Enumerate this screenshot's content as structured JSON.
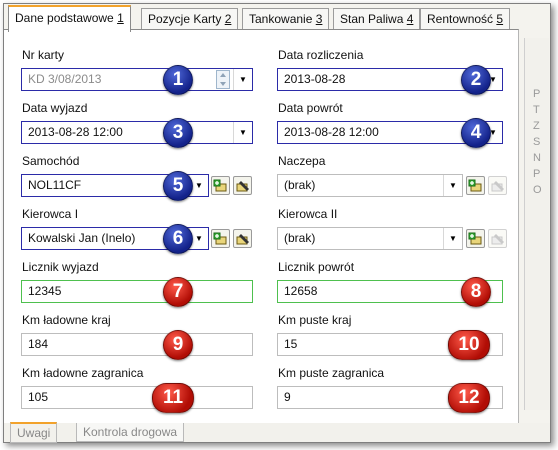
{
  "tabs": [
    {
      "label": "Dane podstawowe",
      "shortcut": "1"
    },
    {
      "label": "Pozycje Karty",
      "shortcut": "2"
    },
    {
      "label": "Tankowanie",
      "shortcut": "3"
    },
    {
      "label": "Stan Paliwa",
      "shortcut": "4"
    },
    {
      "label": "Rentowność",
      "shortcut": "5"
    }
  ],
  "fields": {
    "nr_karty": {
      "label": "Nr karty",
      "value": "KD 3/08/2013",
      "badge": "1"
    },
    "data_rozliczenia": {
      "label": "Data rozliczenia",
      "value": "2013-08-28",
      "badge": "2"
    },
    "data_wyjazd": {
      "label": "Data wyjazd",
      "value": "2013-08-28 12:00",
      "badge": "3"
    },
    "data_powrot": {
      "label": "Data powrót",
      "value": "2013-08-28 12:00",
      "badge": "4"
    },
    "samochod": {
      "label": "Samochód",
      "value": "NOL11CF",
      "badge": "5"
    },
    "naczepa": {
      "label": "Naczepa",
      "value": "(brak)"
    },
    "kierowca1": {
      "label": "Kierowca I",
      "value": "Kowalski Jan (Inelo)",
      "badge": "6"
    },
    "kierowca2": {
      "label": "Kierowca II",
      "value": "(brak)"
    },
    "licznik_wyjazd": {
      "label": "Licznik wyjazd",
      "value": "12345",
      "badge": "7"
    },
    "licznik_powrot": {
      "label": "Licznik powrót",
      "value": "12658",
      "badge": "8"
    },
    "km_ladowne_kraj": {
      "label": "Km ładowne kraj",
      "value": "184",
      "badge": "9"
    },
    "km_puste_kraj": {
      "label": "Km puste kraj",
      "value": "15",
      "badge": "10"
    },
    "km_ladowne_zagranica": {
      "label": "Km ładowne zagranica",
      "value": "105",
      "badge": "11"
    },
    "km_puste_zagranica": {
      "label": "Km puste zagranica",
      "value": "9",
      "badge": "12"
    }
  },
  "side_letters": [
    "P",
    "T",
    "Z",
    "S",
    "N",
    "P",
    "O"
  ],
  "bottom_tabs": [
    "Uwagi",
    "Kontrola drogowa"
  ],
  "colors": {
    "badge_blue": "#13228a",
    "badge_red": "#b10d05",
    "active_tab": "#f2a22b",
    "green_border": "#4ec04e",
    "blue_border": "#2b2ba8"
  }
}
